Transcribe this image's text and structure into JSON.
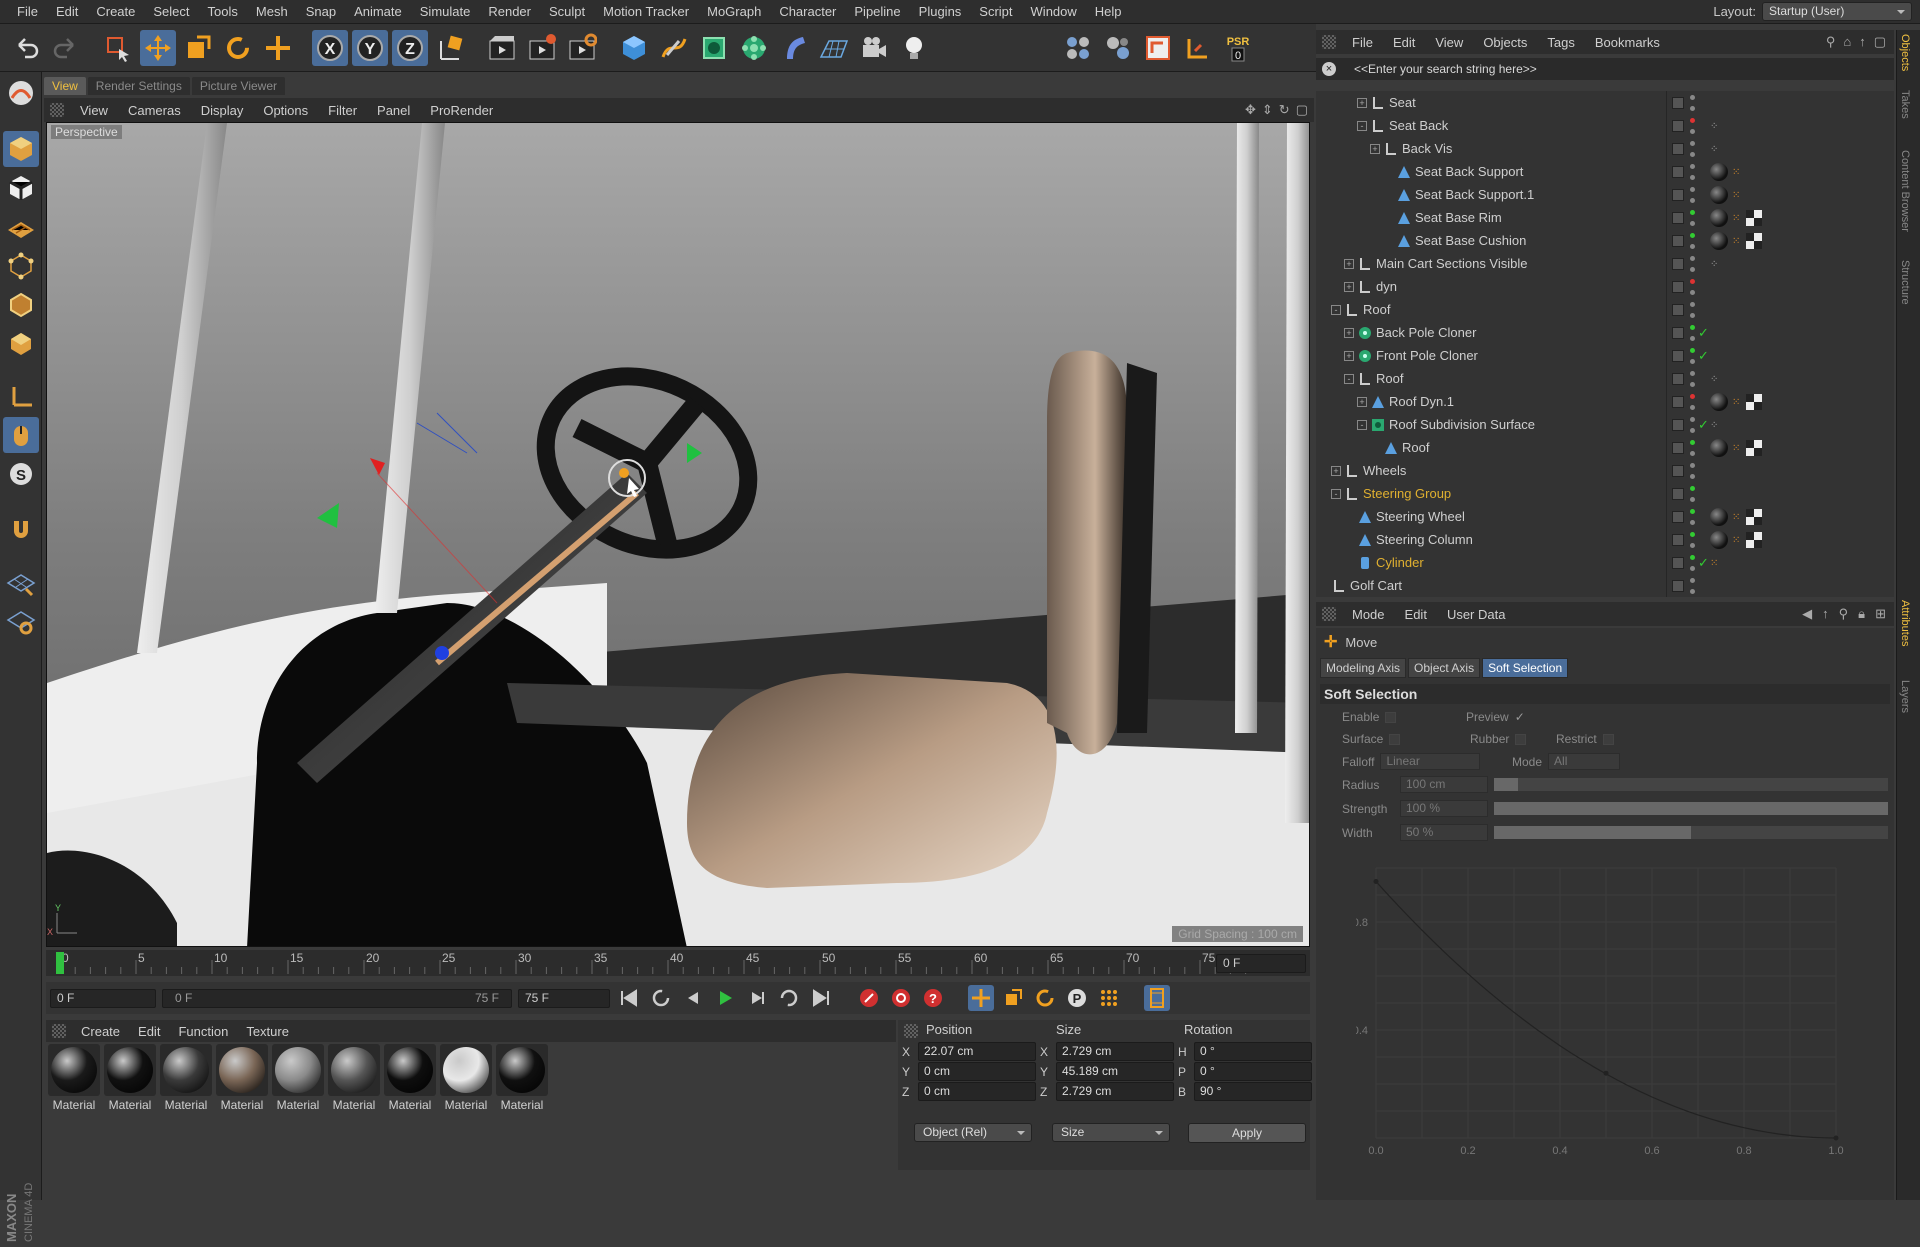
{
  "menubar": {
    "items": [
      "File",
      "Edit",
      "Create",
      "Select",
      "Tools",
      "Mesh",
      "Snap",
      "Animate",
      "Simulate",
      "Render",
      "Sculpt",
      "Motion Tracker",
      "MoGraph",
      "Character",
      "Pipeline",
      "Plugins",
      "Script",
      "Window",
      "Help"
    ],
    "layout_label": "Layout:",
    "layout_value": "Startup (User)"
  },
  "toolbar": {
    "axis_x": "X",
    "axis_y": "Y",
    "axis_z": "Z",
    "psr_label": "PSR",
    "psr_value": "0"
  },
  "viewport_tabs": [
    "View",
    "Render Settings",
    "Picture Viewer"
  ],
  "viewport_menu": [
    "View",
    "Cameras",
    "Display",
    "Options",
    "Filter",
    "Panel",
    "ProRender"
  ],
  "viewport": {
    "label": "Perspective",
    "grid_spacing": "Grid Spacing : 100 cm"
  },
  "timeline": {
    "ticks": [
      "0",
      "5",
      "10",
      "15",
      "20",
      "25",
      "30",
      "35",
      "40",
      "45",
      "50",
      "55",
      "60",
      "65",
      "70",
      "75"
    ],
    "frame_end_label": "0 F",
    "current_frame": "0 F",
    "range_start": "0 F",
    "range_end": "75 F",
    "max_frame": "75 F"
  },
  "material_menu": [
    "Create",
    "Edit",
    "Function",
    "Texture"
  ],
  "materials": [
    {
      "label": "Material",
      "color": "#1a1a1a"
    },
    {
      "label": "Material",
      "color": "#111111"
    },
    {
      "label": "Material",
      "color": "#3a3a3a"
    },
    {
      "label": "Material",
      "color": "#7a6656"
    },
    {
      "label": "Material",
      "color": "#8a8a8a"
    },
    {
      "label": "Material",
      "color": "#555555"
    },
    {
      "label": "Material",
      "color": "#0e0e0e"
    },
    {
      "label": "Material",
      "color": "#e8e8e8"
    },
    {
      "label": "Material",
      "color": "#101010"
    }
  ],
  "coordinates": {
    "headers": {
      "position": "Position",
      "size": "Size",
      "rotation": "Rotation"
    },
    "rows": [
      {
        "axis": "X",
        "pos": "22.07 cm",
        "size_axis": "X",
        "size": "2.729 cm",
        "rot_axis": "H",
        "rot": "0 °"
      },
      {
        "axis": "Y",
        "pos": "0 cm",
        "size_axis": "Y",
        "size": "45.189 cm",
        "rot_axis": "P",
        "rot": "0 °"
      },
      {
        "axis": "Z",
        "pos": "0 cm",
        "size_axis": "Z",
        "size": "2.729 cm",
        "rot_axis": "B",
        "rot": "90 °"
      }
    ],
    "mode": "Object (Rel)",
    "size_mode": "Size",
    "apply": "Apply"
  },
  "brand": {
    "line1": "MAXON",
    "line2": "CINEMA 4D"
  },
  "objects_menu": [
    "File",
    "Edit",
    "View",
    "Objects",
    "Tags",
    "Bookmarks"
  ],
  "objects_search": "<<Enter your search string here>>",
  "objects": [
    {
      "name": "Seat",
      "depth": 3,
      "icon": "null",
      "expand": "+",
      "tags": []
    },
    {
      "name": "Seat Back",
      "depth": 3,
      "icon": "null",
      "expand": "-",
      "tags": [
        "dots"
      ]
    },
    {
      "name": "Back Vis",
      "depth": 4,
      "icon": "null",
      "expand": "+",
      "tags": [
        "dots"
      ]
    },
    {
      "name": "Seat Back Support",
      "depth": 5,
      "icon": "poly",
      "expand": "",
      "tags": [
        "mat",
        "o"
      ]
    },
    {
      "name": "Seat Back Support.1",
      "depth": 5,
      "icon": "poly",
      "expand": "",
      "tags": [
        "mat",
        "o"
      ]
    },
    {
      "name": "Seat Base Rim",
      "depth": 5,
      "icon": "poly",
      "expand": "",
      "tags": [
        "mat",
        "o",
        "chk"
      ]
    },
    {
      "name": "Seat Base Cushion",
      "depth": 5,
      "icon": "poly",
      "expand": "",
      "tags": [
        "mat",
        "o",
        "chk"
      ]
    },
    {
      "name": "Main Cart Sections Visible",
      "depth": 2,
      "icon": "null",
      "expand": "+",
      "tags": [
        "dots"
      ]
    },
    {
      "name": "dyn",
      "depth": 2,
      "icon": "null",
      "expand": "+",
      "tags": []
    },
    {
      "name": "Roof",
      "depth": 1,
      "icon": "null",
      "expand": "-",
      "tags": []
    },
    {
      "name": "Back Pole Cloner",
      "depth": 2,
      "icon": "cloner",
      "expand": "+",
      "tags": []
    },
    {
      "name": "Front Pole Cloner",
      "depth": 2,
      "icon": "cloner",
      "expand": "+",
      "tags": []
    },
    {
      "name": "Roof",
      "depth": 2,
      "icon": "null",
      "expand": "-",
      "tags": [
        "dots"
      ]
    },
    {
      "name": "Roof Dyn.1",
      "depth": 3,
      "icon": "poly",
      "expand": "+",
      "tags": [
        "mat",
        "o",
        "chk"
      ]
    },
    {
      "name": "Roof Subdivision Surface",
      "depth": 3,
      "icon": "sds",
      "expand": "-",
      "tags": [
        "dots"
      ]
    },
    {
      "name": "Roof",
      "depth": 4,
      "icon": "poly",
      "expand": "",
      "tags": [
        "mat",
        "o",
        "chk"
      ]
    },
    {
      "name": "Wheels",
      "depth": 1,
      "icon": "null",
      "expand": "+",
      "tags": []
    },
    {
      "name": "Steering Group",
      "depth": 1,
      "icon": "null",
      "expand": "-",
      "tags": [],
      "highlight": true
    },
    {
      "name": "Steering Wheel",
      "depth": 2,
      "icon": "poly",
      "expand": "",
      "tags": [
        "mat",
        "o",
        "chk"
      ]
    },
    {
      "name": "Steering Column",
      "depth": 2,
      "icon": "poly",
      "expand": "",
      "tags": [
        "mat",
        "o",
        "chk"
      ]
    },
    {
      "name": "Cylinder",
      "depth": 2,
      "icon": "cyl",
      "expand": "",
      "tags": [
        "o"
      ],
      "highlight": true
    },
    {
      "name": "Golf Cart",
      "depth": 0,
      "icon": "null",
      "expand": "",
      "tags": []
    }
  ],
  "attributes_menu": [
    "Mode",
    "Edit",
    "User Data"
  ],
  "attributes": {
    "mode_title": "Move",
    "tabs": [
      "Modeling Axis",
      "Object Axis",
      "Soft Selection"
    ],
    "section": "Soft Selection",
    "enable": "Enable",
    "preview": "Preview",
    "surface": "Surface",
    "rubber": "Rubber",
    "restrict": "Restrict",
    "falloff_label": "Falloff",
    "falloff_value": "Linear",
    "mode_label": "Mode",
    "mode_value": "All",
    "radius_label": "Radius",
    "radius_value": "100 cm",
    "radius_fraction": 0.06,
    "strength_label": "Strength",
    "strength_value": "100 %",
    "strength_fraction": 1.0,
    "width_label": "Width",
    "width_value": "50 %",
    "width_fraction": 0.5
  },
  "falloff_curve": {
    "y_ticks": [
      "0.8",
      "0.4"
    ],
    "x_ticks": [
      "0.0",
      "0.2",
      "0.4",
      "0.6",
      "0.8",
      "1.0"
    ]
  },
  "edge_tabs": [
    "Objects",
    "Takes",
    "Content Browser",
    "Structure",
    "Attributes",
    "Layers"
  ],
  "colors": {
    "accent": "#4a6d9a",
    "highlight": "#e0b030",
    "tab_active": "#f0c040"
  }
}
